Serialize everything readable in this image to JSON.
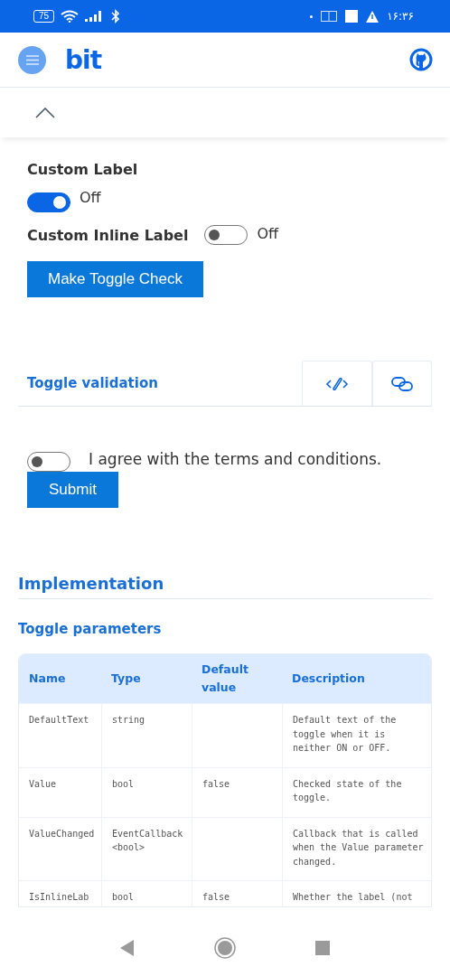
{
  "status_bar": {
    "battery": "75",
    "time": "۱۶:۳۶"
  },
  "header": {
    "logo": "bit"
  },
  "custom_label_demo": {
    "label": "Custom Label",
    "toggle": {
      "checked": true,
      "text": "Off"
    },
    "inline_label": "Custom Inline Label",
    "inline_toggle": {
      "checked": false,
      "text": "Off"
    },
    "button": "Make Toggle Check"
  },
  "validation": {
    "title": "Toggle validation",
    "toggle": {
      "checked": false
    },
    "agree_text": "I agree with the terms and conditions.",
    "submit": "Submit"
  },
  "implementation": {
    "title": "Implementation",
    "subtitle": "Toggle parameters",
    "table": {
      "columns": [
        "Name",
        "Type",
        "Default value",
        "Description"
      ],
      "rows": [
        [
          "DefaultText",
          "string",
          null,
          "Default text of the toggle when it is neither ON or OFF."
        ],
        [
          "Value",
          "bool",
          "false",
          "Checked state of the toggle."
        ],
        [
          "ValueChanged",
          "EventCallback<bool>",
          null,
          "Callback that is called when the Value parameter changed."
        ],
        [
          "IsInlineLab",
          "bool",
          "false",
          "Whether the label (not"
        ]
      ]
    }
  }
}
